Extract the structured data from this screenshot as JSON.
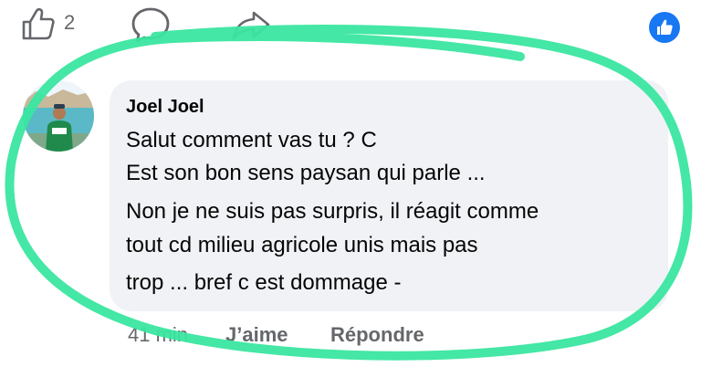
{
  "top_bar": {
    "like_count": "2",
    "icons": [
      "thumbs-up-icon",
      "comment-icon",
      "share-icon",
      "like-reaction-icon"
    ]
  },
  "comment": {
    "author": "Joel Joel",
    "lines": [
      "Salut comment vas tu ? C",
      "Est son bon sens paysan qui parle ...",
      "Non je ne suis pas surpris, il réagit comme",
      "tout cd milieu agricole unis mais pas",
      "trop ... bref c est dommage -"
    ],
    "time": "41 min",
    "like_label": "J’aime",
    "reply_label": "Répondre"
  },
  "colors": {
    "facebook_blue": "#1877f2",
    "bubble_bg": "#f0f2f5",
    "secondary_text": "#65676b",
    "highlight_green": "#3ae6a0"
  }
}
